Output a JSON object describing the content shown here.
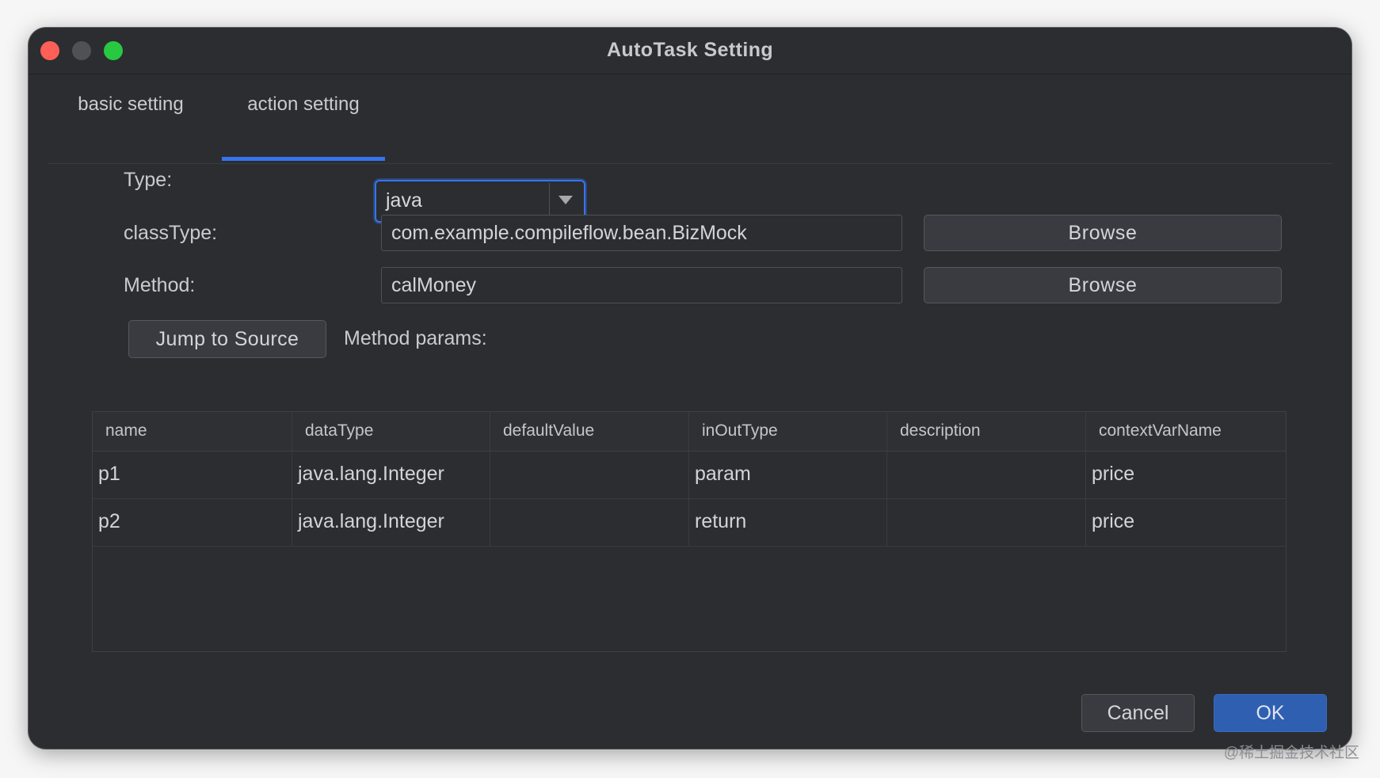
{
  "window": {
    "title": "AutoTask Setting"
  },
  "tabs": [
    {
      "label": "basic setting",
      "active": false
    },
    {
      "label": "action setting",
      "active": true
    }
  ],
  "form": {
    "type_label": "Type:",
    "type_value": "java",
    "classtype_label": "classType:",
    "classtype_value": "com.example.compileflow.bean.BizMock",
    "method_label": "Method:",
    "method_value": "calMoney",
    "browse_label": "Browse",
    "jump_to_source_label": "Jump to Source",
    "method_params_label": "Method params:"
  },
  "params_table": {
    "columns": [
      "name",
      "dataType",
      "defaultValue",
      "inOutType",
      "description",
      "contextVarName"
    ],
    "rows": [
      [
        "p1",
        "java.lang.Integer",
        "",
        "param",
        "",
        "price"
      ],
      [
        "p2",
        "java.lang.Integer",
        "",
        "return",
        "",
        "price"
      ]
    ]
  },
  "footer": {
    "cancel_label": "Cancel",
    "ok_label": "OK"
  },
  "watermark": "@稀土掘金技术社区",
  "colors": {
    "accent": "#3574f0",
    "ok_button": "#2f5fb0",
    "window_bg": "#2b2d30",
    "close": "#fe5f57",
    "maximize": "#28c840"
  }
}
